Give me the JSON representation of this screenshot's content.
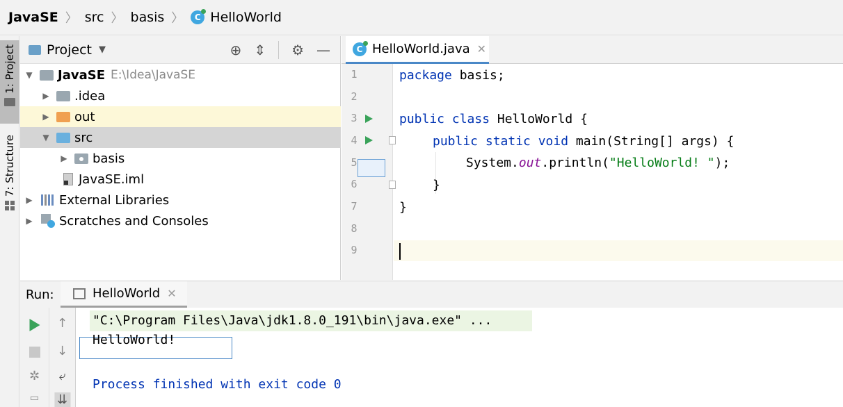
{
  "breadcrumb": {
    "project": "JavaSE",
    "folder": "src",
    "package": "basis",
    "file": "HelloWorld"
  },
  "left_strip": {
    "project_tab": "1: Project",
    "structure_tab": "7: Structure"
  },
  "project_panel": {
    "title": "Project",
    "tree": [
      {
        "label": "JavaSE",
        "sub": "E:\\Idea\\JavaSE"
      },
      {
        "label": ".idea"
      },
      {
        "label": "out"
      },
      {
        "label": "src"
      },
      {
        "label": "basis"
      },
      {
        "label": "JavaSE.iml"
      },
      {
        "label": "External Libraries"
      },
      {
        "label": "Scratches and Consoles"
      }
    ]
  },
  "editor": {
    "tab_label": "HelloWorld.java",
    "line_numbers": [
      "1",
      "2",
      "3",
      "4",
      "5",
      "6",
      "7",
      "8",
      "9"
    ],
    "code": {
      "l1_kw": "package",
      "l1_rest": " basis;",
      "l3_kw": "public class",
      "l3_rest": " HelloWorld {",
      "l4_kw": "public static void",
      "l4_rest": " main(String[] args) {",
      "l5_pre": "System.",
      "l5_field": "out",
      "l5_mid": ".println(",
      "l5_str": "\"HelloWorld! \"",
      "l5_end": ");",
      "l6": "}",
      "l7": "}"
    }
  },
  "run_panel": {
    "label": "Run:",
    "tab_label": "HelloWorld",
    "cmd": "\"C:\\Program Files\\Java\\jdk1.8.0_191\\bin\\java.exe\" ...",
    "output": "HelloWorld!",
    "exit": "Process finished with exit code 0"
  },
  "colors": {
    "keyword": "#0033b3",
    "string": "#067d17",
    "field": "#871094",
    "run_green": "#3aa35a",
    "accent_blue": "#4a88c7"
  },
  "icons": [
    "class-icon",
    "folder-icon",
    "target-icon",
    "collapse-icon",
    "gear-icon",
    "minimize-icon",
    "run-icon",
    "stop-icon",
    "up-icon",
    "down-icon",
    "wrap-icon",
    "scroll-end-icon"
  ]
}
